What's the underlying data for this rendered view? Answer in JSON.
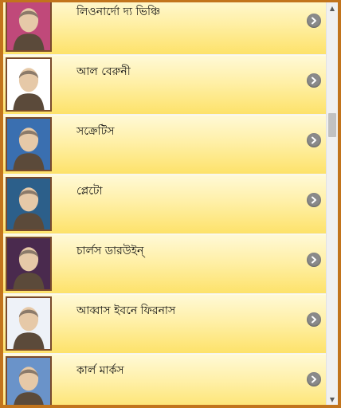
{
  "list": {
    "items": [
      {
        "name": "লিওনার্দো দ্য ভিঞ্চি",
        "image": "portrait-leonardo",
        "bg": "#c0497a"
      },
      {
        "name": "আল বেরুনী",
        "image": "portrait-al-biruni",
        "bg": "#ffffff"
      },
      {
        "name": "সক্রেটিস",
        "image": "portrait-socrates",
        "bg": "#3a6fb0"
      },
      {
        "name": "প্লেটো",
        "image": "portrait-plato",
        "bg": "#2c5f8a"
      },
      {
        "name": "চার্লস ডারউইন্",
        "image": "portrait-darwin",
        "bg": "#4a2a4e"
      },
      {
        "name": "আব্বাস ইবনে ফিরনাস",
        "image": "portrait-abbas-ibn-firnas",
        "bg": "#eef2f8"
      },
      {
        "name": "কার্ল মার্কস",
        "image": "portrait-karl-marx",
        "bg": "#6a93c9"
      }
    ]
  },
  "icons": {
    "chevron": "chevron-right-circle-icon"
  },
  "colors": {
    "frame": "#c2741c",
    "row_top": "#fff9d6",
    "row_bottom": "#fde26a",
    "chevron": "#8a8a8a"
  }
}
